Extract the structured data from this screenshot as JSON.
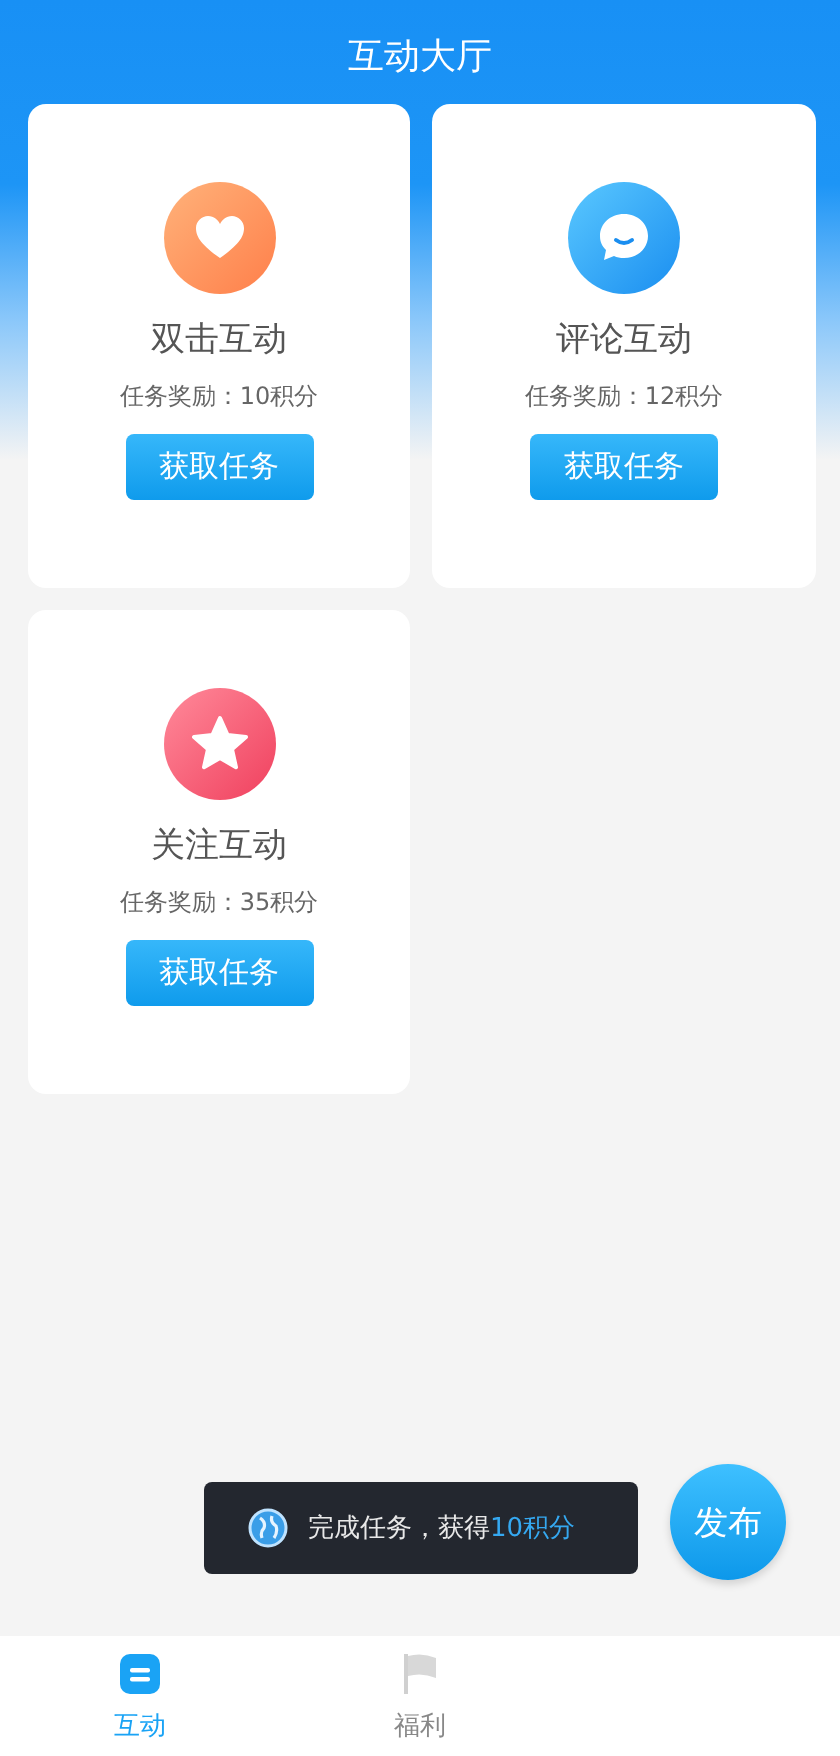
{
  "header": {
    "title": "互动大厅"
  },
  "tasks": [
    {
      "kind": "like",
      "title": "双击互动",
      "reward": "任务奖励：10积分",
      "button": "获取任务"
    },
    {
      "kind": "comment",
      "title": "评论互动",
      "reward": "任务奖励：12积分",
      "button": "获取任务"
    },
    {
      "kind": "follow",
      "title": "关注互动",
      "reward": "任务奖励：35积分",
      "button": "获取任务"
    }
  ],
  "toast": {
    "text": "完成任务，获得",
    "highlight": "10积分"
  },
  "fab": {
    "label": "发布"
  },
  "tabs": [
    {
      "kind": "interact",
      "label": "互动",
      "selected": true
    },
    {
      "kind": "flag",
      "label": "福利",
      "selected": false
    }
  ]
}
